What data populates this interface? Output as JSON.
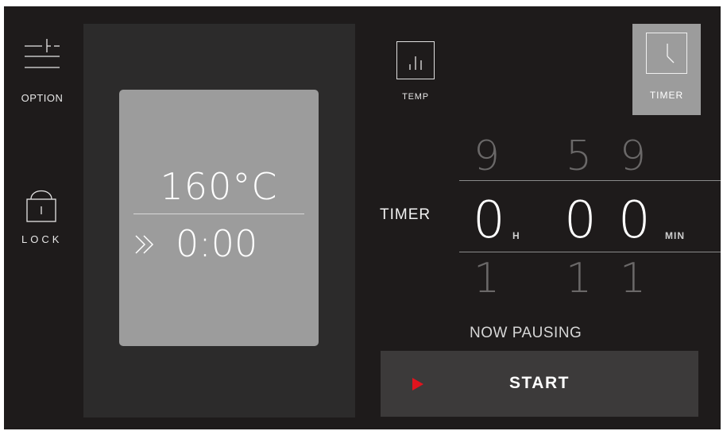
{
  "sidebar": {
    "option_label": "OPTION",
    "lock_label": "LOCK"
  },
  "display": {
    "temperature": "160°C",
    "time": "0:00"
  },
  "controls": {
    "temp_label": "TEMP",
    "timer_label": "TIMER"
  },
  "timer_picker": {
    "title": "TIMER",
    "hours": {
      "prev": "9",
      "value": "0",
      "next": "1",
      "unit": "H"
    },
    "minutes_tens": {
      "prev": "5",
      "value": "0",
      "next": "1"
    },
    "minutes_ones": {
      "prev": "9",
      "value": "0",
      "next": "1",
      "unit": "MIN"
    }
  },
  "status": "NOW PAUSING",
  "start_label": "START",
  "colors": {
    "background": "#1e1b1b",
    "panel": "#2c2b2b",
    "card": "#9c9c9c",
    "active_tab": "#9c9c9c",
    "start_button": "#3c3a3a",
    "play_icon": "#e0141e"
  },
  "icons": {
    "option": "sliders-icon",
    "lock": "padlock-icon",
    "temp": "bar-gauge-icon",
    "timer": "clock-icon",
    "time_indicator": "double-chevron-right-icon",
    "start": "play-icon"
  }
}
